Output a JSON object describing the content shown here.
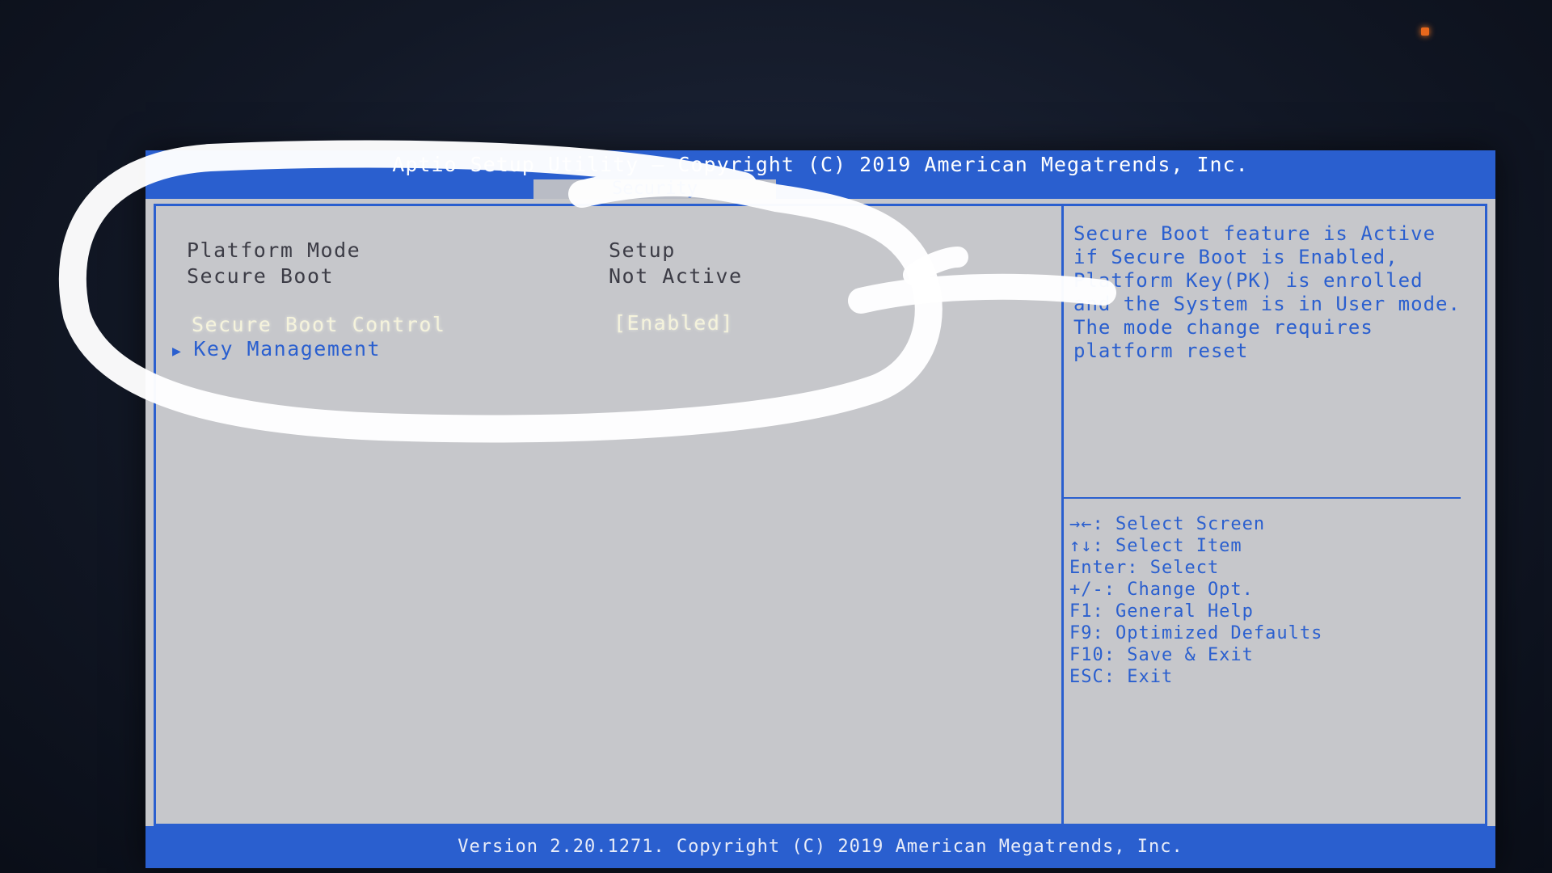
{
  "header": {
    "title": "Aptio Setup Utility – Copyright (C) 2019 American Megatrends, Inc.",
    "active_tab": "Security"
  },
  "settings": {
    "platform_mode": {
      "label": "Platform Mode",
      "value": "Setup"
    },
    "secure_boot": {
      "label": "Secure Boot",
      "value": "Not Active"
    },
    "secure_boot_control": {
      "label": "Secure Boot Control",
      "value": "[Enabled]"
    },
    "key_management": {
      "label": "Key Management",
      "arrow": "▶"
    }
  },
  "help": {
    "lines": [
      "Secure Boot feature is Active",
      "if Secure Boot is Enabled,",
      "Platform Key(PK) is enrolled",
      "and the System is in User mode.",
      "The mode change requires",
      "platform reset"
    ]
  },
  "keys": [
    "→←: Select Screen",
    "↑↓: Select Item",
    "Enter: Select",
    "+/-: Change Opt.",
    "F1: General Help",
    "F9: Optimized Defaults",
    "F10: Save & Exit",
    "ESC: Exit"
  ],
  "footer": {
    "text": "Version 2.20.1271. Copyright (C) 2019 American Megatrends, Inc."
  },
  "colors": {
    "bios_blue": "#2a5fcf",
    "panel_gray": "#c6c7cb",
    "highlight": "#f5f3dc",
    "annotation": "#ffffff"
  }
}
